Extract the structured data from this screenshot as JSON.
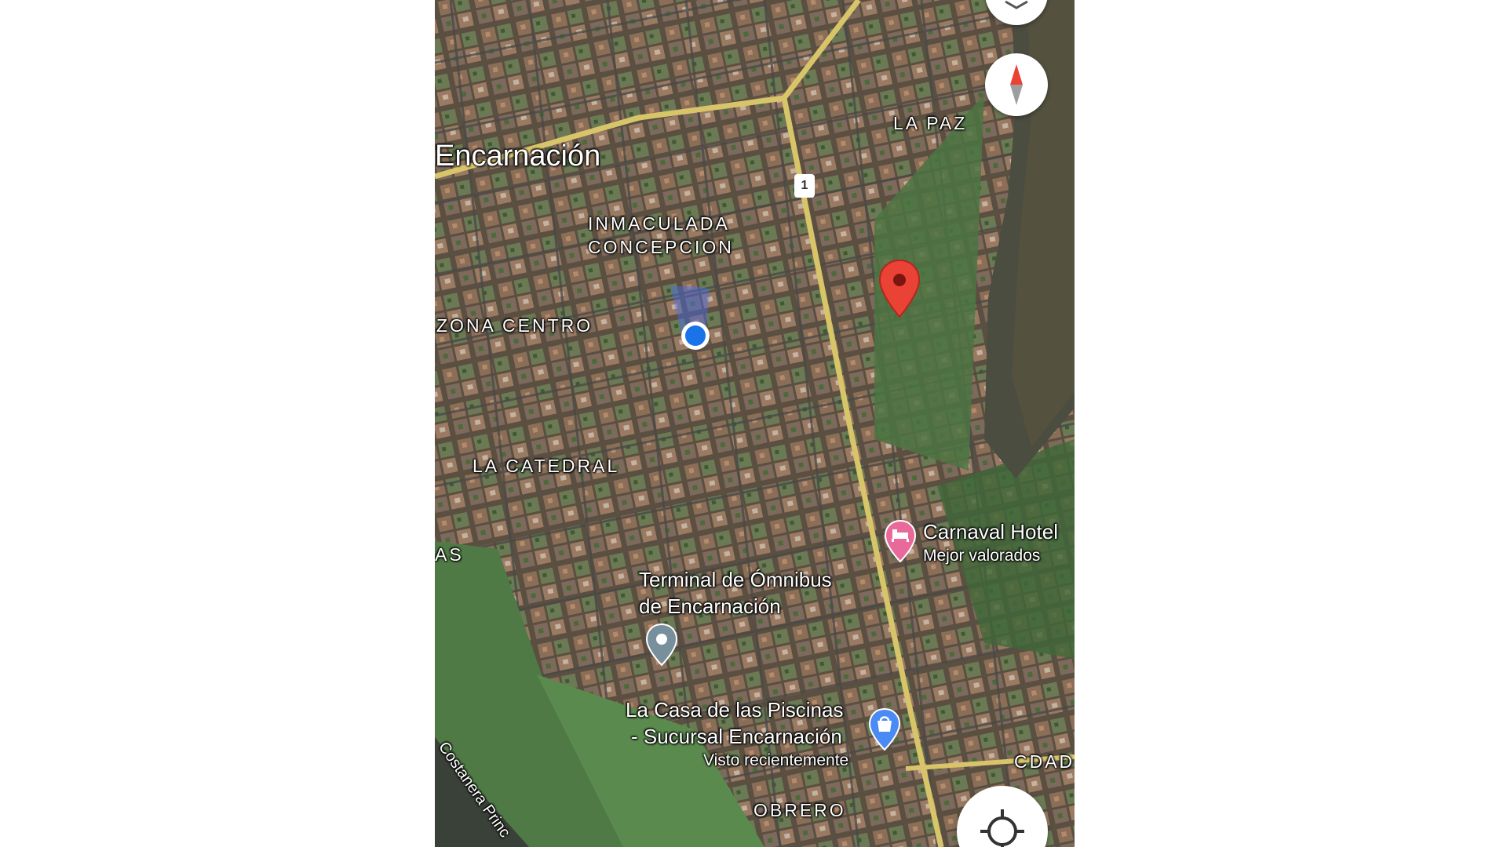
{
  "map": {
    "city_label": "Encarnación",
    "neighborhoods": {
      "la_paz": "LA PAZ",
      "inmaculada_1": "INMACULADA",
      "inmaculada_2": "CONCEPCION",
      "zona_centro": "ZONA CENTRO",
      "la_catedral": "LA CATEDRAL",
      "obrero": "OBRERO",
      "cdad": "CDAD",
      "edge_left": "AS"
    },
    "route_shield": "1",
    "road_label": "Costanera Princ",
    "places": [
      {
        "name": "Carnaval Hotel",
        "subtitle": "Mejor valorados",
        "icon": "hotel-pin-icon",
        "color": "#e8699a"
      },
      {
        "name_line1": "Terminal de Ómnibus",
        "name_line2": "de Encarnación",
        "icon": "transit-pin-icon",
        "color": "#78909c"
      },
      {
        "name_line1": "La Casa de las Piscinas",
        "name_line2": "- Sucursal Encarnación",
        "subtitle": "Visto recientemente",
        "icon": "shopping-pin-icon",
        "color": "#4a8af4"
      }
    ],
    "dropped_pin": {
      "icon": "red-map-pin-icon",
      "color": "#ea4335"
    },
    "my_location": {
      "icon": "blue-location-dot-icon",
      "color": "#1a73e8"
    },
    "controls": {
      "layers_icon": "layers-icon",
      "compass_icon": "compass-icon",
      "recenter_icon": "my-location-crosshair-icon"
    }
  }
}
